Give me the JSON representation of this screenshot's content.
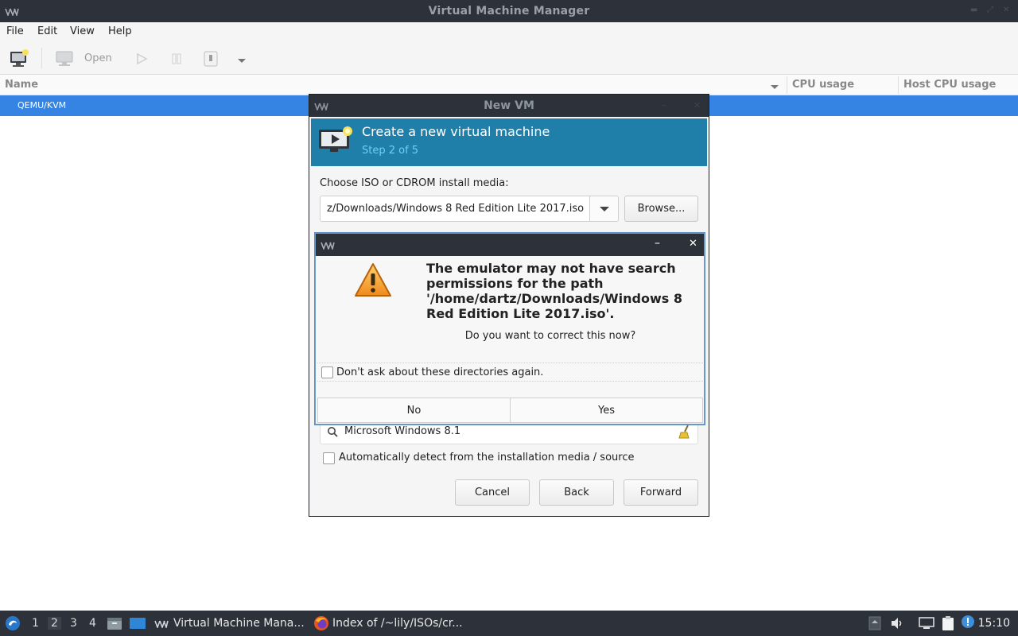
{
  "window": {
    "title": "Virtual Machine Manager"
  },
  "menubar": {
    "items": [
      "File",
      "Edit",
      "View",
      "Help"
    ]
  },
  "toolbar": {
    "open_label": "Open"
  },
  "list": {
    "columns": [
      "Name",
      "CPU usage",
      "Host CPU usage"
    ],
    "rows": [
      "QEMU/KVM"
    ]
  },
  "new_vm": {
    "title": "New VM",
    "banner_title": "Create a new virtual machine",
    "banner_step": "Step 2 of 5",
    "choose_label": "Choose ISO or CDROM install media:",
    "iso_path": "z/Downloads/Windows 8 Red Edition Lite 2017.iso",
    "browse_label": "Browse...",
    "os_search_value": "Microsoft Windows 8.1",
    "auto_detect_label": "Automatically detect from the installation media / source",
    "cancel_label": "Cancel",
    "back_label": "Back",
    "forward_label": "Forward"
  },
  "warning": {
    "message": "The emulator may not have search permissions for the path '/home/dartz/Downloads/Windows 8 Red Edition Lite 2017.iso'.",
    "question": "Do you want to correct this now?",
    "checkbox_label": "Don't ask about these directories again.",
    "no_label": "No",
    "yes_label": "Yes",
    "minimize_glyph": "–",
    "close_glyph": "✕"
  },
  "taskbar": {
    "workspaces": [
      "1",
      "2",
      "3",
      "4"
    ],
    "active_workspace": "2",
    "tasks": [
      "Virtual Machine Mana...",
      "Index of /~lily/ISOs/cr..."
    ],
    "clock": "15:10"
  },
  "colors": {
    "titlebar": "#2d323a",
    "selection": "#3584e4",
    "banner": "#1f7fa8",
    "banner_step_text": "#6fd0f2",
    "warning_border": "#6a9fce"
  }
}
